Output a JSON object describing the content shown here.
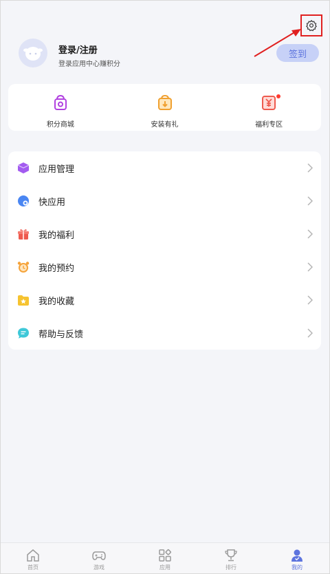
{
  "header": {
    "login_title": "登录/注册",
    "login_subtitle": "登录应用中心赚积分",
    "checkin_label": "签到",
    "settings_icon": "gear-icon",
    "highlight_color": "#e02020"
  },
  "quick_actions": [
    {
      "label": "积分商城",
      "icon": "points-bag-icon",
      "color": "#b141e0"
    },
    {
      "label": "安装有礼",
      "icon": "install-gift-icon",
      "color": "#f0a030"
    },
    {
      "label": "福利专区",
      "icon": "welfare-icon",
      "color": "#ee5a4e",
      "badge": true
    }
  ],
  "menu": [
    {
      "label": "应用管理",
      "icon": "cube-icon",
      "color": "#a35bf0"
    },
    {
      "label": "快应用",
      "icon": "quick-app-icon",
      "color": "#4a86f2"
    },
    {
      "label": "我的福利",
      "icon": "gift-icon",
      "color": "#ee5a4e"
    },
    {
      "label": "我的预约",
      "icon": "alarm-clock-icon",
      "color": "#f5a33a"
    },
    {
      "label": "我的收藏",
      "icon": "star-folder-icon",
      "color": "#f6c330"
    },
    {
      "label": "帮助与反馈",
      "icon": "chat-bubble-icon",
      "color": "#3ec8d8"
    }
  ],
  "tabs": [
    {
      "label": "首页",
      "icon": "home-icon"
    },
    {
      "label": "游戏",
      "icon": "gamepad-icon"
    },
    {
      "label": "应用",
      "icon": "apps-grid-icon"
    },
    {
      "label": "排行",
      "icon": "trophy-icon"
    },
    {
      "label": "我的",
      "icon": "user-icon",
      "active": true
    }
  ],
  "colors": {
    "accent": "#5d74de",
    "page_bg": "#f4f5f9"
  }
}
